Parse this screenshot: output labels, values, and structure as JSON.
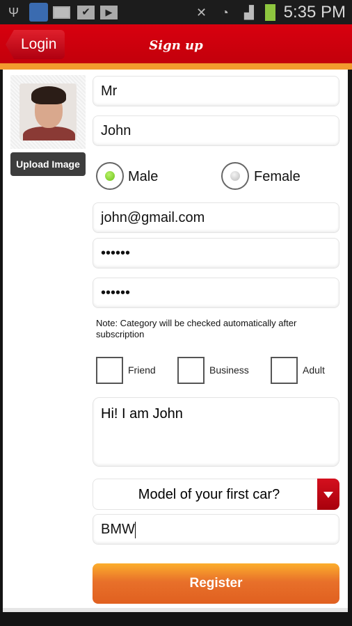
{
  "status_bar": {
    "time": "5:35 PM",
    "icons": [
      "usb-icon",
      "app-icon",
      "mail-icon",
      "task-icon",
      "play-store-icon",
      "mute-icon",
      "wifi-icon",
      "signal-icon",
      "battery-charging-icon"
    ]
  },
  "app_bar": {
    "back_label": "Login",
    "title": "Sign up"
  },
  "profile": {
    "upload_label": "Upload Image"
  },
  "form": {
    "title_value": "Mr",
    "name_value": "John",
    "gender": {
      "options": [
        "Male",
        "Female"
      ],
      "selected": "Male"
    },
    "email_value": "john@gmail.com",
    "password_value": "••••••",
    "confirm_password_value": "••••••",
    "note": "Note: Category will be checked automatically after subscription",
    "categories": [
      {
        "label": "Friend",
        "checked": false
      },
      {
        "label": "Business",
        "checked": false
      },
      {
        "label": "Adult",
        "checked": false
      }
    ],
    "about_value": "Hi! I am John",
    "security_question": "Model of your first car?",
    "security_answer": "BMW",
    "register_label": "Register"
  },
  "colors": {
    "app_bar": "#d0000e",
    "accent_orange": "#f29a2e",
    "radio_selected": "#7fd321"
  }
}
